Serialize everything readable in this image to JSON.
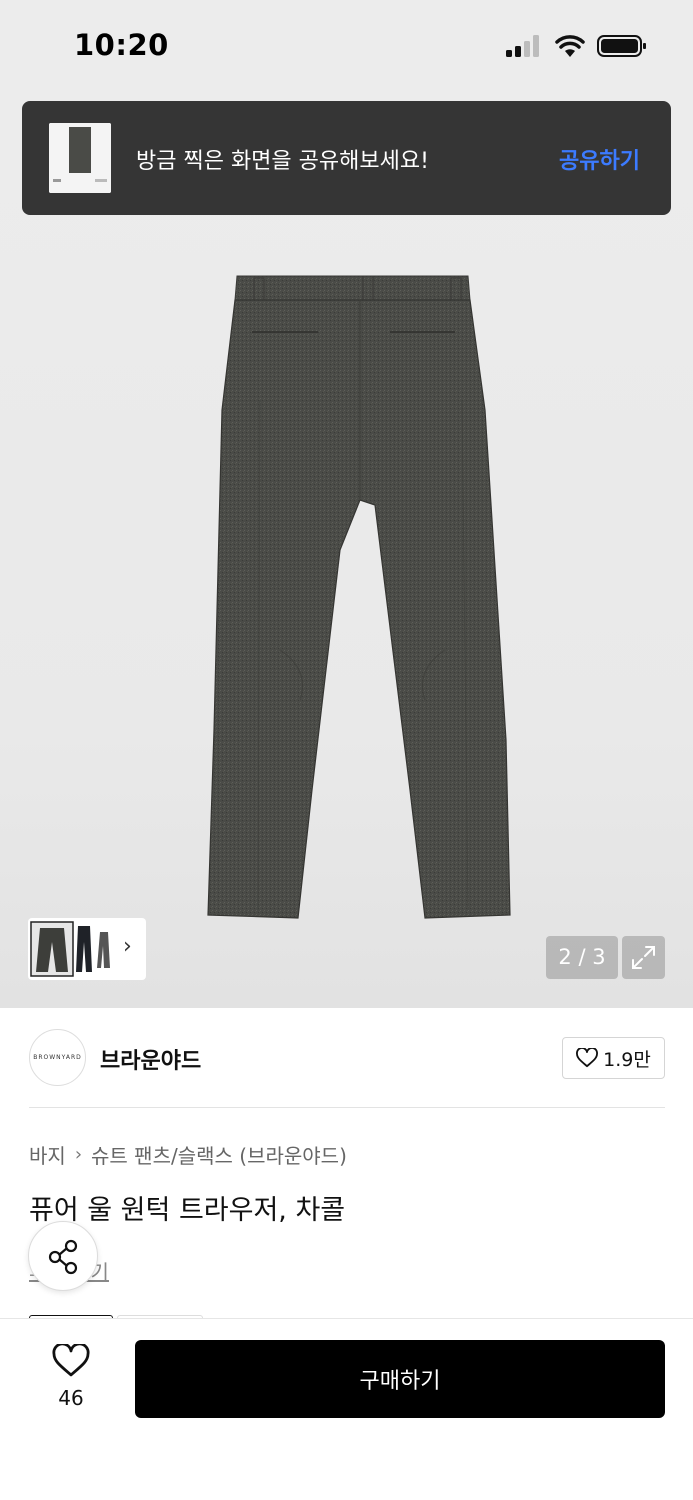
{
  "status_bar": {
    "time": "10:20"
  },
  "toast": {
    "message": "방금 찍은 화면을 공유해보세요!",
    "action": "공유하기"
  },
  "gallery": {
    "counter": "2 / 3",
    "thumb_more_icon": "chevron-right-icon",
    "expand_icon": "expand-icon"
  },
  "brand": {
    "logo_text": "BROWNYARD",
    "name": "브라운야드",
    "likes": "1.9만"
  },
  "breadcrumb": {
    "category": "바지",
    "subcategory": "슈트 팬츠/슬랙스 (브라운야드)"
  },
  "product": {
    "title": "퓨어 울 원턱 트라우저, 차콜",
    "review_link": "후기 보기"
  },
  "bottom_bar": {
    "wish_count": "46",
    "buy_label": "구매하기"
  },
  "colors": {
    "buy_button": "#000000",
    "toast_bg": "#353535",
    "toast_action": "#3c7bff",
    "image_bg": "#ececec"
  }
}
